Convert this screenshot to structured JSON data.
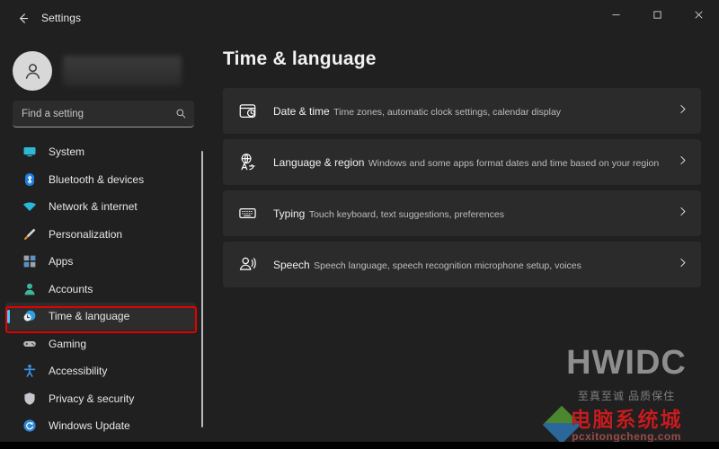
{
  "window": {
    "app_title": "Settings",
    "back_icon": "back-arrow-icon",
    "minimize_label": "—",
    "maximize_label": "□",
    "close_label": "✕"
  },
  "account": {
    "avatar_icon": "person-avatar-icon",
    "name": ""
  },
  "search": {
    "placeholder": "Find a setting",
    "value": "",
    "icon": "search-icon"
  },
  "sidebar": {
    "items": [
      {
        "label": "System",
        "icon": "monitor-icon",
        "color": "#2fb8d4",
        "selected": false
      },
      {
        "label": "Bluetooth & devices",
        "icon": "bluetooth-icon",
        "color": "#1f7fe0",
        "selected": false
      },
      {
        "label": "Network & internet",
        "icon": "wifi-icon",
        "color": "#29b8d8",
        "selected": false
      },
      {
        "label": "Personalization",
        "icon": "paintbrush-icon",
        "color": "#e08a2a",
        "selected": false
      },
      {
        "label": "Apps",
        "icon": "apps-grid-icon",
        "color": "#8c9aa8",
        "selected": false
      },
      {
        "label": "Accounts",
        "icon": "person-icon",
        "color": "#3fb59a",
        "selected": false
      },
      {
        "label": "Time & language",
        "icon": "clock-globe-icon",
        "color": "#2f9fe0",
        "selected": true
      },
      {
        "label": "Gaming",
        "icon": "gamepad-icon",
        "color": "#b9b9b9",
        "selected": false
      },
      {
        "label": "Accessibility",
        "icon": "accessibility-person-icon",
        "color": "#3a8fdb",
        "selected": false
      },
      {
        "label": "Privacy & security",
        "icon": "shield-icon",
        "color": "#c3c7cc",
        "selected": false
      },
      {
        "label": "Windows Update",
        "icon": "refresh-circle-icon",
        "color": "#2f86d8",
        "selected": false
      }
    ],
    "highlight_color": "#e60000",
    "selection_accent": "#4cc2ff"
  },
  "main": {
    "page_title": "Time & language",
    "cards": [
      {
        "title": "Date & time",
        "subtitle": "Time zones, automatic clock settings, calendar display",
        "icon": "calendar-clock-icon",
        "chevron": "chevron-right-icon"
      },
      {
        "title": "Language & region",
        "subtitle": "Windows and some apps format dates and time based on your region",
        "icon": "language-globe-icon",
        "chevron": "chevron-right-icon"
      },
      {
        "title": "Typing",
        "subtitle": "Touch keyboard, text suggestions, preferences",
        "icon": "keyboard-icon",
        "chevron": "chevron-right-icon"
      },
      {
        "title": "Speech",
        "subtitle": "Speech language, speech recognition microphone setup, voices",
        "icon": "speech-person-icon",
        "chevron": "chevron-right-icon"
      }
    ]
  },
  "watermark": {
    "brand": "HWIDC",
    "slogan": "至真至诚 品质保住",
    "logo_text": "电脑系统城",
    "logo_url": "pcxitongcheng.com"
  }
}
